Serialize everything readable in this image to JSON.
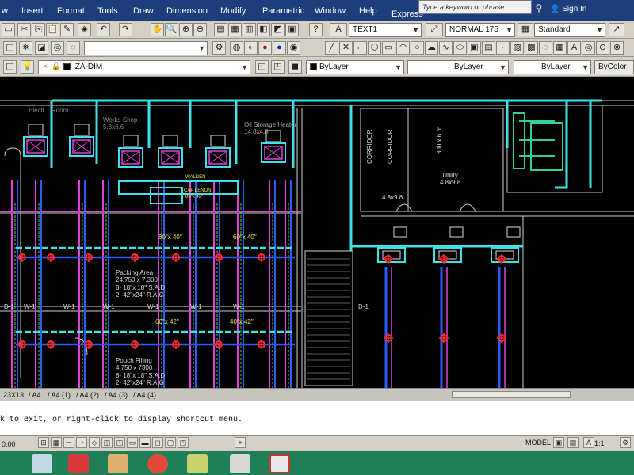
{
  "menu": {
    "items": [
      "w",
      "Insert",
      "Format",
      "Tools",
      "Draw",
      "Dimension",
      "Modify",
      "Parametric",
      "Window",
      "Help",
      "Express"
    ],
    "search_placeholder": "Type a keyword or phrase",
    "sign_in": "Sign In"
  },
  "toolbar2": {
    "text_style": "TEXT1",
    "dim_style": "NORMAL 175",
    "table_style": "Standard"
  },
  "toolbar3": {
    "layer": "ZA-DIM",
    "color": "ByLayer",
    "linetype": "ByLayer",
    "lineweight": "ByLayer",
    "plot_style": "ByColor"
  },
  "drawing": {
    "labels": {
      "electrical_room": "Electr... Room",
      "works_shop": "Works Shop\n5.8x6.6",
      "oil_storage": "Oil Storage Heater\n14.8x4.8",
      "packing_area": "Packing Area\n24.750 x 7.300",
      "packing_sad": "8- 18\"x 18\" S.A.D",
      "packing_rag": "2- 42\"x24\" R.A.G",
      "pouch_filling": "Pouch Filling\n4.750 x 7300",
      "pouch_sad": "8- 18\"x 18\" S.A.D",
      "pouch_rag": "2- 42\"x24\" R.A.G",
      "utility": "Utility\n4.8x9.8",
      "room_a": "4.8x9.8",
      "corridor_1": "CORRIDOR",
      "corridor_2": "CORRIDOR",
      "corridor_3": "300 x 6 m",
      "duct_60x40_a": "60\"x 40\"",
      "duct_60x40_b": "60\"x 40\"",
      "duct_60x42": "60\"x 42\"",
      "duct_40x42": "40\"x 42\"",
      "unit_label_1": "WALDEN",
      "unit_label_2": "CAP LENON",
      "unit_size": "80\"x 42\"",
      "w1_a": "W-1",
      "w1_b": "W-1",
      "w1_c": "W-1",
      "w1_d": "W-1",
      "w1_e": "W-1",
      "w1_f": "W-1",
      "d1_a": "D-1",
      "d1_b": "D-1"
    }
  },
  "tabs": [
    "23X13",
    "A4",
    "A4 (1)",
    "A4 (2)",
    "A4 (3)",
    "A4 (4)"
  ],
  "command_line": "k to exit, or right-click to display shortcut menu.",
  "status": {
    "coords": "0.00",
    "model": "MODEL",
    "scale": "1:1"
  },
  "colors": {
    "menu_bg": "#1c3f7c",
    "toolbar_bg": "#d4d0c8",
    "cyan": "#3fe0e6",
    "magenta": "#e040d8",
    "blue": "#2a5dff",
    "red": "#ff2a2a",
    "taskbar": "#1f7f56"
  }
}
